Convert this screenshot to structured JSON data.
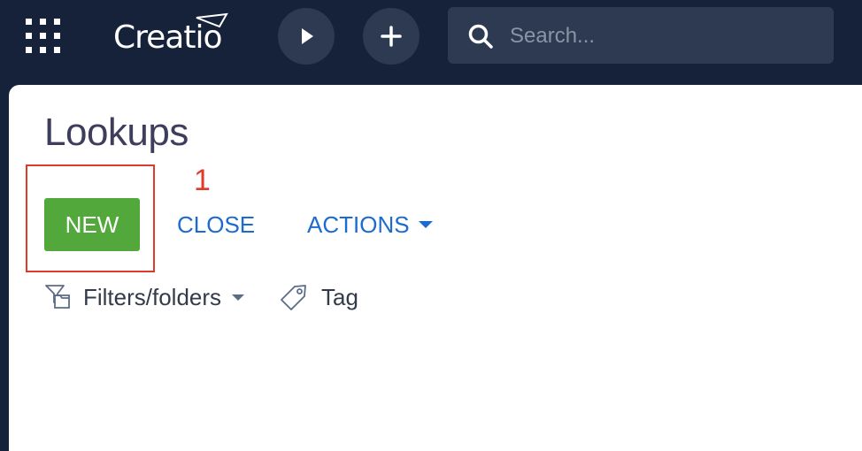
{
  "app": {
    "logo_text": "Creatio"
  },
  "topbar": {
    "apps_icon": "grid-icon",
    "run_process_icon": "play-icon",
    "add_icon": "plus-icon",
    "search": {
      "placeholder": "Search...",
      "icon": "search-icon"
    }
  },
  "page": {
    "title": "Lookups"
  },
  "toolbar": {
    "new_label": "NEW",
    "close_label": "CLOSE",
    "actions_label": "ACTIONS"
  },
  "annotation": {
    "callout_number": "1",
    "color": "#e03a2a"
  },
  "filters": {
    "filters_label": "Filters/folders",
    "tag_label": "Tag"
  },
  "colors": {
    "topbar_bg": "#15223a",
    "new_button": "#52a83a",
    "link": "#1e6bd0"
  }
}
